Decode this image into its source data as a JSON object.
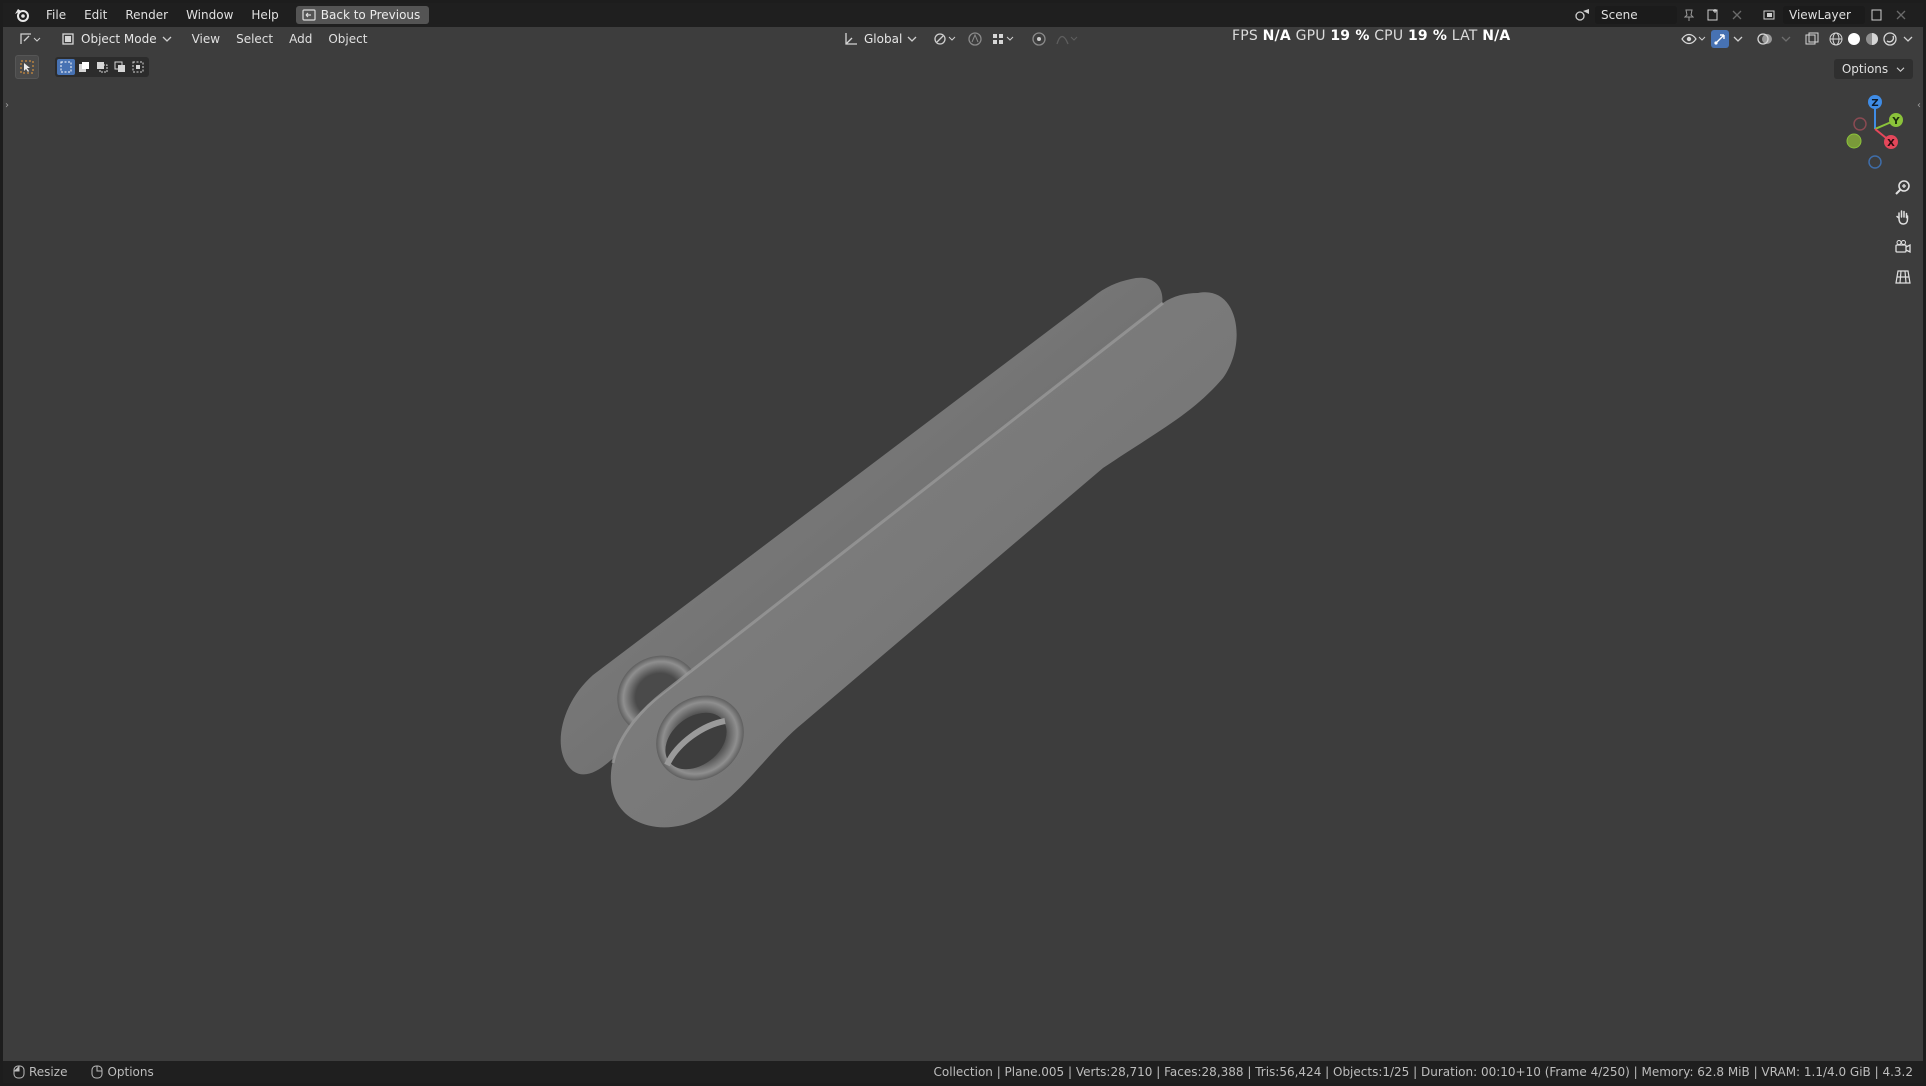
{
  "menu": {
    "items": [
      "File",
      "Edit",
      "Render",
      "Window",
      "Help"
    ],
    "back_button": "Back to Previous"
  },
  "scene": {
    "name": "Scene",
    "view_layer": "ViewLayer"
  },
  "header": {
    "mode": "Object Mode",
    "menus": [
      "View",
      "Select",
      "Add",
      "Object"
    ],
    "orientation": "Global"
  },
  "stats": {
    "fps_label": "FPS",
    "fps_value": "N/A",
    "gpu_label": "GPU",
    "gpu_value": "19 %",
    "cpu_label": "CPU",
    "cpu_value": "19 %",
    "lat_label": "LAT",
    "lat_value": "N/A"
  },
  "viewport": {
    "options_label": "Options",
    "background": "#3d3d3d",
    "object_color": "#7a7a7a",
    "gizmo": {
      "z_label": "Z",
      "y_label": "Y",
      "x_label": "X",
      "colors": {
        "x": "#e5475a",
        "y": "#8bc33a",
        "z": "#3f8ce6"
      }
    }
  },
  "statusbar": {
    "resize": "Resize",
    "options": "Options",
    "info": "Collection | Plane.005 | Verts:28,710 | Faces:28,388 | Tris:56,424 | Objects:1/25 | Duration: 00:10+10 (Frame 4/250) | Memory: 62.8 MiB | VRAM: 1.1/4.0 GiB | 4.3.2"
  },
  "icons": [
    "blender-logo-icon",
    "back-icon",
    "editor-type-icon",
    "object-mode-icon",
    "transform-orientation-icon",
    "pivot-icon",
    "snap-icon",
    "proportional-edit-icon",
    "visibility-icon",
    "gizmo-icon",
    "overlay-icon",
    "xray-icon",
    "wireframe-shading-icon",
    "solid-shading-icon",
    "material-shading-icon",
    "rendered-shading-icon",
    "zoom-icon",
    "pan-hand-icon",
    "camera-icon",
    "grid-ortho-icon",
    "select-box-icon"
  ]
}
